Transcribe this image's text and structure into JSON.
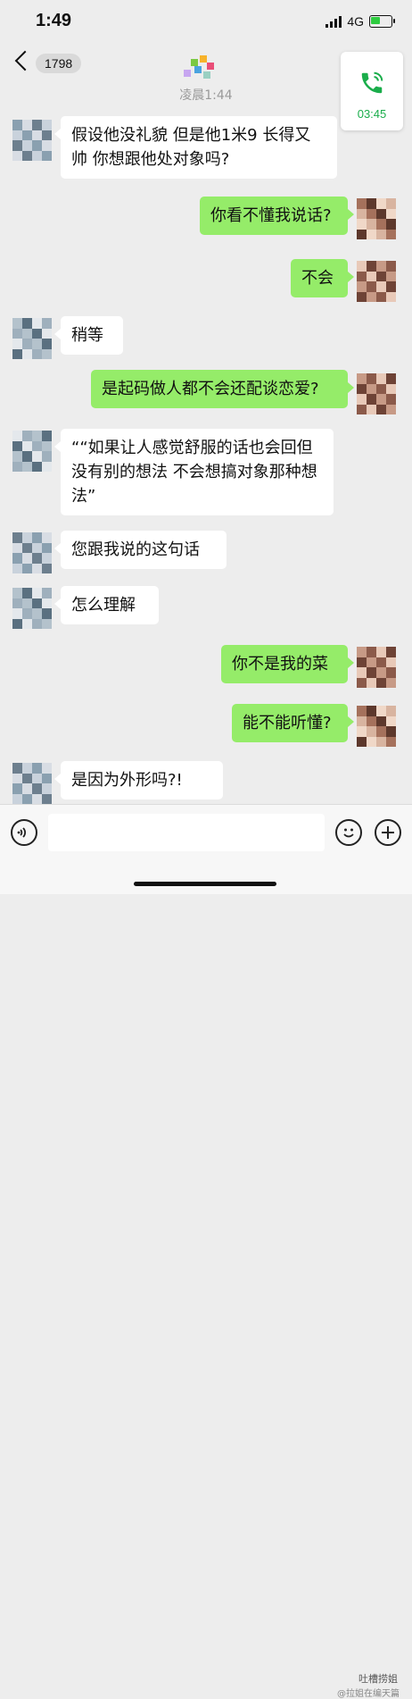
{
  "status_bar": {
    "time": "1:49",
    "network": "4G"
  },
  "header": {
    "back_count": "1798"
  },
  "call_card": {
    "duration": "03:45"
  },
  "timestamp": "凌晨1:44",
  "messages": [
    {
      "side": "in",
      "text": "假设他没礼貌 但是他1米9 长得又帅 你想跟他处对象吗?"
    },
    {
      "side": "out",
      "text": "你看不懂我说话?"
    },
    {
      "side": "out",
      "text": "不会"
    },
    {
      "side": "in",
      "text": "稍等"
    },
    {
      "side": "out",
      "text": "是起码做人都不会还配谈恋爱?"
    },
    {
      "side": "in",
      "text": "““如果让人感觉舒服的话也会回但没有别的想法 不会想搞对象那种想法”"
    },
    {
      "side": "in",
      "text": "您跟我说的这句话"
    },
    {
      "side": "in",
      "text": "怎么理解"
    },
    {
      "side": "out",
      "text": "你不是我的菜"
    },
    {
      "side": "out",
      "text": "能不能听懂?"
    },
    {
      "side": "in",
      "text": "是因为外形吗?!"
    }
  ],
  "input_bar": {
    "voice_icon": "voice-icon",
    "emoji_icon": "emoji-icon",
    "plus_icon": "plus-icon"
  },
  "watermark": {
    "line1": "吐槽捞姐",
    "line2": "@拉姐在编天篇"
  },
  "colors": {
    "outgoing": "#95ec69",
    "incoming": "#ffffff",
    "background": "#ededed",
    "call_green": "#1aad4b"
  }
}
